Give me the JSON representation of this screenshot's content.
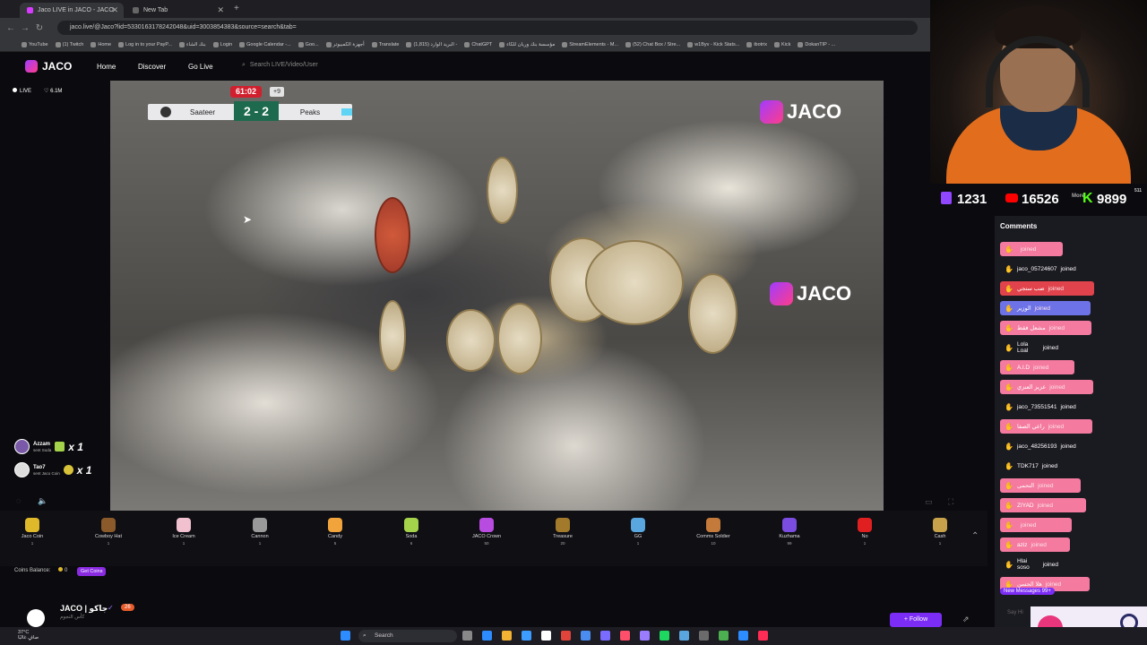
{
  "browser": {
    "tabs": [
      {
        "label": "Jaco LIVE in JACO - JACO"
      },
      {
        "label": "New Tab"
      }
    ],
    "url": "jaco.live/@Jaco?lid=5330163178242048&uid=3003854383&source=search&tab=",
    "bookmarks": [
      "YouTube",
      "(1) Twitch",
      "Home",
      "Log in to your PayP...",
      "بنك الشاء",
      "Login",
      "Google Calendar -...",
      "Goo...",
      "أجهزة الكمبيوتر",
      "Translate",
      "البريد الوارد (1,815) -",
      "ChatGPT",
      "مؤسسة بنك وريان للكاء",
      "StreamElements - M...",
      "(52) Chat Box / Stre...",
      "w1Byv - Kick Stats...",
      "ibotrix",
      "Kick",
      "DokanTIP - ..."
    ]
  },
  "header": {
    "logo": "JACO",
    "nav": [
      "Home",
      "Discover",
      "Go Live"
    ],
    "search_placeholder": "Search LIVE/Video/User"
  },
  "stream": {
    "live_label": "LIVE",
    "viewers": "6.1M",
    "timer": "61:02",
    "extra_time": "+9",
    "home_team": "Saateer",
    "away_team": "Peaks",
    "score": "2 - 2",
    "watermark": "JACO"
  },
  "gift_notifications": [
    {
      "name": "Azzam",
      "action": "sent Soda",
      "mult": "x 1"
    },
    {
      "name": "Tao7",
      "action": "sent Jaco Coin",
      "mult": "x 1"
    }
  ],
  "gifts": [
    {
      "label": "Jaco Coin",
      "price": "1",
      "color": "#e0b92a"
    },
    {
      "label": "Cowboy Hat",
      "price": "1",
      "color": "#8b5a2b"
    },
    {
      "label": "Ice Cream",
      "price": "1",
      "color": "#f2c1d0"
    },
    {
      "label": "Cannon",
      "price": "1",
      "color": "#9a9a9a"
    },
    {
      "label": "Candy",
      "price": "5",
      "color": "#f0a43b"
    },
    {
      "label": "Soda",
      "price": "6",
      "color": "#a4d24b"
    },
    {
      "label": "JACO Crown",
      "price": "50",
      "color": "#b84ce0"
    },
    {
      "label": "Treasure",
      "price": "20",
      "color": "#a37a2c"
    },
    {
      "label": "GG",
      "price": "1",
      "color": "#5aa7e0"
    },
    {
      "label": "Comms Soldier",
      "price": "10",
      "color": "#c47a3a"
    },
    {
      "label": "Kuzhama",
      "price": "99",
      "color": "#7b4ce0"
    },
    {
      "label": "No",
      "price": "1",
      "color": "#e02020"
    },
    {
      "label": "Cash",
      "price": "1",
      "color": "#c8a24a"
    }
  ],
  "coins": {
    "label": "Coins Balance:",
    "value": "0",
    "button": "Get Coins"
  },
  "channel": {
    "name": "JACO | جاكو",
    "sub": "كأس النجوم",
    "level": "26",
    "follow": "+ Follow"
  },
  "counters": {
    "twitch": "1231",
    "youtube": "16526",
    "kick": "9899",
    "more": "More",
    "top": "511"
  },
  "chat": {
    "title": "Comments",
    "new_messages": "New Messages 99+",
    "input_placeholder": "Say Hi",
    "messages": [
      {
        "user": "",
        "text": "joined",
        "style": "pink",
        "width": 70
      },
      {
        "user": "jaco_05724607",
        "text": "joined",
        "style": "plain",
        "width": 95
      },
      {
        "user": "ضب ستجي",
        "text": "joined",
        "style": "red",
        "width": 105
      },
      {
        "user": "الوزير",
        "text": "joined",
        "style": "blue",
        "width": 101
      },
      {
        "user": "مشعل فقط",
        "text": "joined",
        "style": "pink",
        "width": 102
      },
      {
        "user": "Lola Loal",
        "text": "joined",
        "style": "plain",
        "width": 70
      },
      {
        "user": "A.l.D",
        "text": "joined",
        "style": "pink",
        "width": 83
      },
      {
        "user": "عزيز العنزي",
        "text": "joined",
        "style": "pink",
        "width": 104
      },
      {
        "user": "jaco_73551541",
        "text": "joined",
        "style": "plain",
        "width": 95
      },
      {
        "user": "راعي الصفا",
        "text": "joined",
        "style": "pink",
        "width": 103
      },
      {
        "user": "jaco_48256193",
        "text": "joined",
        "style": "plain",
        "width": 95
      },
      {
        "user": "TDK717",
        "text": "joined",
        "style": "plain",
        "width": 65
      },
      {
        "user": "التحمى",
        "text": "joined",
        "style": "pink",
        "width": 90
      },
      {
        "user": "ZIYAD",
        "text": "joined",
        "style": "pink",
        "width": 96
      },
      {
        "user": "",
        "text": "joined",
        "style": "pink",
        "width": 80
      },
      {
        "user": "aziz",
        "text": "joined",
        "style": "pink",
        "width": 78
      },
      {
        "user": "Hlai soso",
        "text": "joined",
        "style": "plain",
        "width": 70
      },
      {
        "user": "هلا الحسن",
        "text": "joined",
        "style": "pink",
        "width": 100
      }
    ]
  },
  "taskbar": {
    "temp": "37°C",
    "weather": "صافٍ غالبًا",
    "search": "Search"
  }
}
